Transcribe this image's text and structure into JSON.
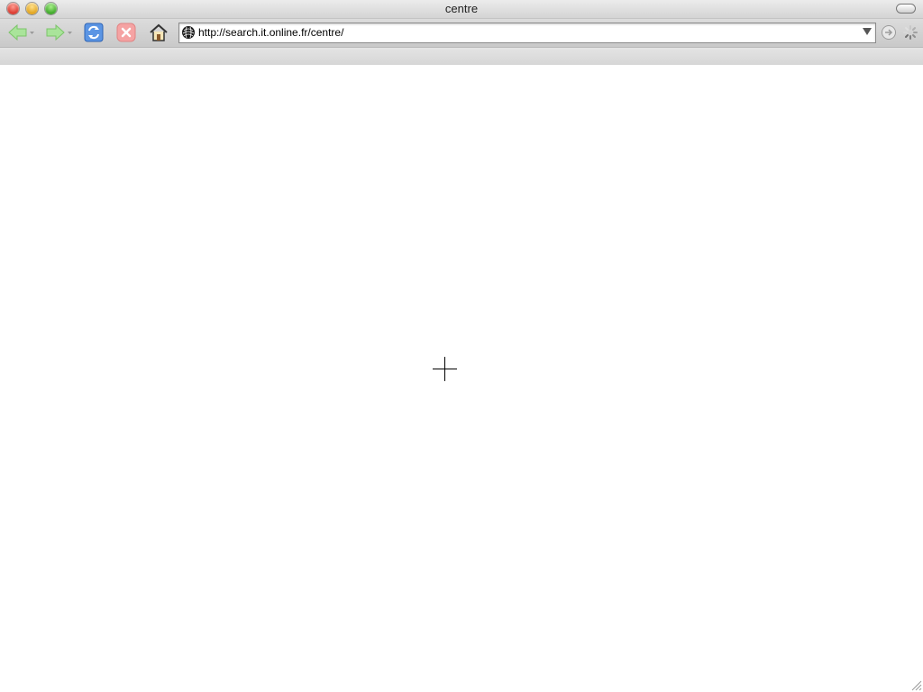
{
  "window": {
    "title": "centre"
  },
  "toolbar": {
    "back_icon": "back-arrow-icon",
    "forward_icon": "forward-arrow-icon",
    "reload_icon": "reload-icon",
    "stop_icon": "stop-icon",
    "home_icon": "home-icon",
    "go_icon": "go-icon",
    "throbber_icon": "loading-spinner-icon"
  },
  "address_bar": {
    "url": "http://search.it.online.fr/centre/",
    "favicon": "site-favicon"
  },
  "content": {
    "cursor_icon": "crosshair-cursor-icon"
  },
  "colors": {
    "nav_arrow": "#8fd67a",
    "reload": "#3f7fd9",
    "stop": "#f08c8c"
  }
}
